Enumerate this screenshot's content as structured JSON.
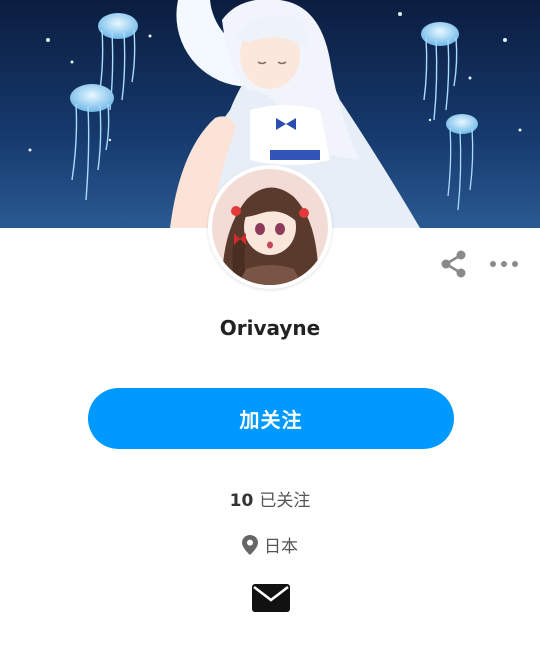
{
  "profile": {
    "username": "Orivayne",
    "follow_label": "加关注",
    "following_count": "10",
    "following_label": "已关注",
    "location": "日本"
  },
  "icons": {
    "share": "share-icon",
    "more": "more-icon",
    "location": "location-pin-icon",
    "message": "envelope-icon"
  },
  "colors": {
    "accent": "#0099ff",
    "icon_gray": "#8a8a8a",
    "text_dark": "#222222"
  }
}
